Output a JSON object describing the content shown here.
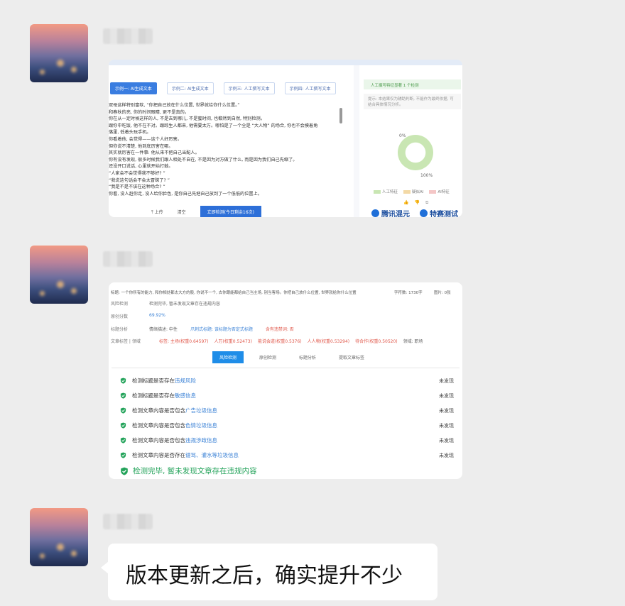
{
  "s1": {
    "tabs": [
      "示例一: AI生成文本",
      "示例二: AI生成文本",
      "示例三: 人工撰写文本",
      "示例四: 人工撰写文本"
    ],
    "text_lines": [
      "双母这样特别富软, “你把自己放在什么位置, 世界就给你什么位置。”",
      "和春秋的亮, 你的时间眼睛, 更不是真的。",
      "你在从一定时候这样的人, 不是去到哪儿, 不是蜜时间, 也都然到自然, 特别检测。",
      "跟你中吃饭, 他不在不对。跟踪生人都来, 他需要太万。哪怕是了一个全是 “大人物” 的场合, 你也不会摸着角",
      "落里, 低着头玩手机。",
      "你看着他, 会觉得——这个人好厉害。",
      "但你说不清楚, 他到底厉害在哪。",
      "其实就厉害在一件事: 他从来不把自己当配人。",
      "你有没有发现, 很多时候我们跟人相处不自在, 不是因为对方做了什么, 而是因为我们自己先缩了。",
      "还没开口说话, 心里就开始打鼓。",
      "“人家会不会觉得我不够好? ”",
      "“我说这句话会不会太冒昧了? ”",
      "“我是不是不该在这种场合? ”",
      "你看, 没人赶你走, 没人给你脸色, 是你自己先把自己放到了一个低低的位置上。"
    ],
    "upload_label": "上传",
    "clear_label": "清空",
    "detect_label": "立即检测(今日剩余16次)",
    "right_header": "人工撰写特征显著   1 个检测",
    "right_note": "提示: 本结果仅为辅助判断, 不能作为最终依据, 可结合具体情况分析。",
    "pct_top": "0%",
    "pct_bottom": "100%",
    "legend": [
      "人工特征",
      "疑似AI",
      "AI特征"
    ],
    "brand1": "腾讯混元",
    "brand2": "特赛测试"
  },
  "s2": {
    "title": "标题: 一个你所有的能力, 和你相处都太大方的股, 你说不一个, 去你跟能都给自己当主场, 别当客场。你把自己放什么位置, 世界就给你什么位置",
    "word_count": "字符数: 1730字",
    "image_count": "图片: 0张",
    "risk_key": "风险检测",
    "risk_val": "检测完毕, 暂未发现文章存在违规内容",
    "orig_key": "原创分数",
    "orig_val": "69.92%",
    "title_key": "标题分析",
    "title_parts": [
      "情绪描述: 中性",
      "爪刺式标题: 该标题为否定式标题",
      "含有违禁词: 否"
    ],
    "tag_key": "文章标签 | 领域",
    "tag_parts": [
      "标签: 主场(权重0.64597)",
      "人万(权重0.52473)",
      "能说会道(权重0.5376)",
      "人人物(权重0.53294)",
      "待合作(权重0.50520)",
      "领域: 职场"
    ],
    "tabs": [
      "风险检测",
      "原创检测",
      "标题分析",
      "提取文章标签"
    ],
    "checks": [
      {
        "prefix": "检测标题是否存在",
        "hl": "违规风险",
        "status": "未发现"
      },
      {
        "prefix": "检测标题是否存在",
        "hl": "敏感信息",
        "status": "未发现"
      },
      {
        "prefix": "检测文章内容是否包含",
        "hl": "广告垃圾信息",
        "status": "未发现"
      },
      {
        "prefix": "检测文章内容是否包含",
        "hl": "色情垃圾信息",
        "status": "未发现"
      },
      {
        "prefix": "检测文章内容是否包含",
        "hl": "违规涉政信息",
        "status": "未发现"
      },
      {
        "prefix": "检测文章内容是否存在",
        "hl": "谩骂、灌水等垃圾信息",
        "status": "未发现"
      }
    ],
    "final": "检测完毕, 暂未发现文章存在违规内容"
  },
  "message": "版本更新之后，确实提升不少",
  "colors": {
    "accent": "#3a7de0",
    "ok": "#23a35a",
    "bg": "#ededed"
  }
}
